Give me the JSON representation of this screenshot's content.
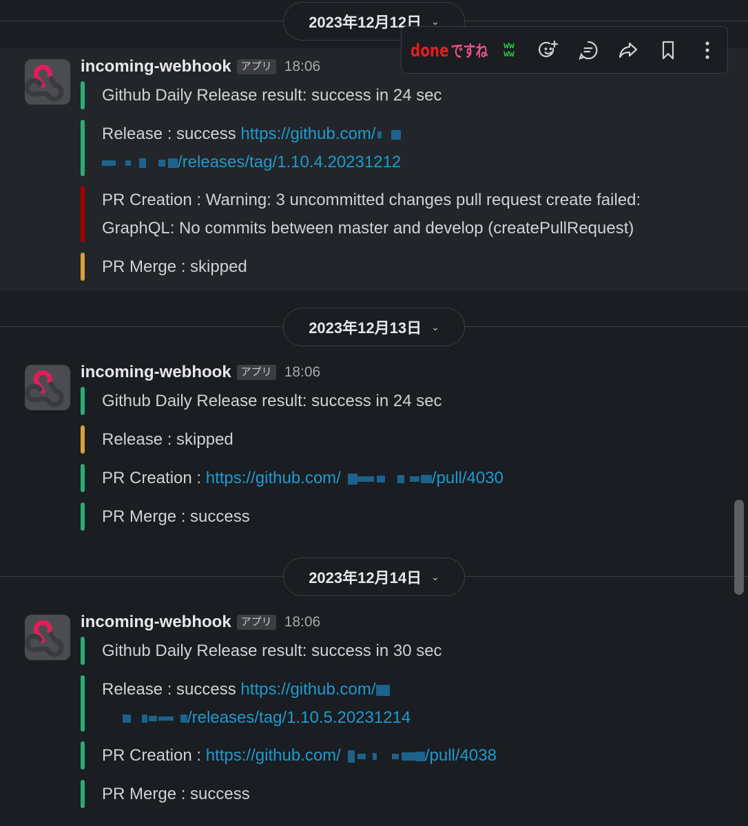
{
  "dates": [
    "2023年12月12日",
    "2023年12月13日",
    "2023年12月14日"
  ],
  "messages": [
    {
      "sender": "incoming-webhook",
      "badge": "アプリ",
      "time": "18:06",
      "summary": "Github Daily Release result: success in 24 sec",
      "release_label": "Release : success ",
      "release_link_a": "https://github.com/",
      "release_link_b": "/releases/tag/1.10.4.20231212",
      "pr_creation_line1": "PR Creation :  Warning: 3 uncommitted changes pull request create failed:",
      "pr_creation_line2": "GraphQL: No commits between master and develop (createPullRequest)",
      "pr_merge": "PR Merge : skipped"
    },
    {
      "sender": "incoming-webhook",
      "badge": "アプリ",
      "time": "18:06",
      "summary": "Github Daily Release result: success in 24 sec",
      "release": "Release : skipped",
      "pr_creation_label": "PR Creation : ",
      "pr_link_a": "https://github.com/",
      "pr_link_b": "/pull/4030",
      "pr_merge": "PR Merge : success"
    },
    {
      "sender": "incoming-webhook",
      "badge": "アプリ",
      "time": "18:06",
      "summary": "Github Daily Release result: success in 30 sec",
      "release_label": "Release : success ",
      "release_link_a": "https://github.com/",
      "release_link_b": "/releases/tag/1.10.5.20231214",
      "pr_creation_label": "PR Creation : ",
      "pr_link_a": "https://github.com/",
      "pr_link_b": "/pull/4038",
      "pr_merge": "PR Merge : success"
    }
  ],
  "toolbar": {
    "reactions": [
      "done",
      "ですね",
      "ww ww"
    ],
    "icons": [
      "add-reaction-icon",
      "reply-in-thread-icon",
      "share-icon",
      "bookmark-icon",
      "more-actions-icon"
    ]
  },
  "colors": {
    "success": "#2bac76",
    "failure": "#a30200",
    "skipped": "#daa038",
    "link": "#1d9bd1",
    "background": "#1a1d21"
  }
}
